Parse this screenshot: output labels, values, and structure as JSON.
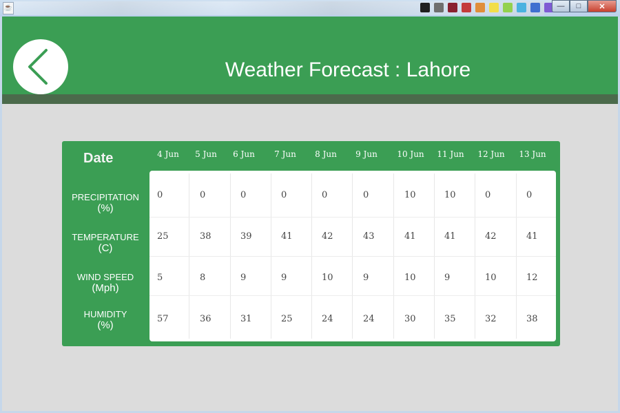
{
  "window": {
    "icon": "java-cup-icon",
    "buttons": {
      "minimize": "—",
      "maximize": "□",
      "close": "✕"
    },
    "swatches": [
      "#1f1f1f",
      "#6f6f6f",
      "#8a2030",
      "#c43b3b",
      "#e08e3b",
      "#f2de4a",
      "#93d14e",
      "#4ab2e0",
      "#3f6fd0",
      "#7e5bd3"
    ]
  },
  "header": {
    "title": "Weather Forecast :  Lahore",
    "back_icon": "chevron-left-icon",
    "colors": {
      "primary": "#3b9e54",
      "bar": "#4b6a4b"
    }
  },
  "table": {
    "date_label": "Date",
    "dates": [
      "4 Jun",
      "5 Jun",
      "6 Jun",
      "7 Jun",
      "8 Jun",
      "9 Jun",
      "10 Jun",
      "11 Jun",
      "12 Jun",
      "13 Jun"
    ],
    "rows": [
      {
        "label_line1": "PRECIPITATION",
        "label_line2": "(%)",
        "values": [
          "0",
          "0",
          "0",
          "0",
          "0",
          "0",
          "10",
          "10",
          "0",
          "0"
        ]
      },
      {
        "label_line1": "TEMPERATURE",
        "label_line2": "(C)",
        "values": [
          "25",
          "38",
          "39",
          "41",
          "42",
          "43",
          "41",
          "41",
          "42",
          "41"
        ]
      },
      {
        "label_line1": "WIND SPEED",
        "label_line2": "(Mph)",
        "values": [
          "5",
          "8",
          "9",
          "9",
          "10",
          "9",
          "10",
          "9",
          "10",
          "12"
        ]
      },
      {
        "label_line1": "HUMIDITY",
        "label_line2": "(%)",
        "values": [
          "57",
          "36",
          "31",
          "25",
          "24",
          "24",
          "30",
          "35",
          "32",
          "38"
        ]
      }
    ]
  }
}
